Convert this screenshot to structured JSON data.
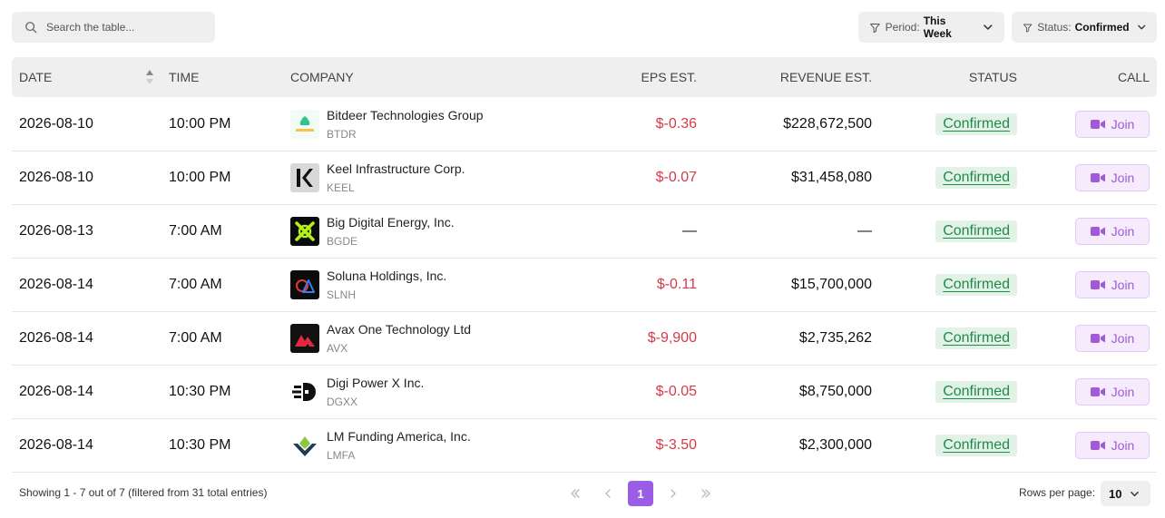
{
  "search": {
    "placeholder": "Search the table..."
  },
  "filters": {
    "period": {
      "label": "Period:",
      "value": "This Week"
    },
    "status": {
      "label": "Status:",
      "value": "Confirmed"
    }
  },
  "table": {
    "headers": {
      "date": "DATE",
      "time": "TIME",
      "company": "COMPANY",
      "eps": "EPS EST.",
      "revenue": "REVENUE EST.",
      "status": "STATUS",
      "call": "CALL"
    },
    "rows": [
      {
        "date": "2026-08-10",
        "time": "10:00 PM",
        "company": "Bitdeer Technologies Group",
        "ticker": "BTDR",
        "logo": "bitdeer-logo",
        "eps": "$-0.36",
        "revenue": "$228,672,500",
        "status": "Confirmed",
        "call": "Join"
      },
      {
        "date": "2026-08-10",
        "time": "10:00 PM",
        "company": "Keel Infrastructure Corp.",
        "ticker": "KEEL",
        "logo": "keel-logo",
        "eps": "$-0.07",
        "revenue": "$31,458,080",
        "status": "Confirmed",
        "call": "Join"
      },
      {
        "date": "2026-08-13",
        "time": "7:00 AM",
        "company": "Big Digital Energy, Inc.",
        "ticker": "BGDE",
        "logo": "bgde-logo",
        "eps": "—",
        "revenue": "—",
        "status": "Confirmed",
        "call": "Join"
      },
      {
        "date": "2026-08-14",
        "time": "7:00 AM",
        "company": "Soluna Holdings, Inc.",
        "ticker": "SLNH",
        "logo": "soluna-logo",
        "eps": "$-0.11",
        "revenue": "$15,700,000",
        "status": "Confirmed",
        "call": "Join"
      },
      {
        "date": "2026-08-14",
        "time": "7:00 AM",
        "company": "Avax One Technology Ltd",
        "ticker": "AVX",
        "logo": "avax-logo",
        "eps": "$-9,900",
        "revenue": "$2,735,262",
        "status": "Confirmed",
        "call": "Join"
      },
      {
        "date": "2026-08-14",
        "time": "10:30 PM",
        "company": "Digi Power X Inc.",
        "ticker": "DGXX",
        "logo": "digipower-logo",
        "eps": "$-0.05",
        "revenue": "$8,750,000",
        "status": "Confirmed",
        "call": "Join"
      },
      {
        "date": "2026-08-14",
        "time": "10:30 PM",
        "company": "LM Funding America, Inc.",
        "ticker": "LMFA",
        "logo": "lmfunding-logo",
        "eps": "$-3.50",
        "revenue": "$2,300,000",
        "status": "Confirmed",
        "call": "Join"
      }
    ]
  },
  "footer": {
    "showing": "Showing 1 - 7 out of 7 (filtered from 31 total entries)",
    "current_page": "1",
    "rows_per_page_label": "Rows per page:",
    "rows_per_page": "10"
  },
  "colors": {
    "negative": "#d63a4a",
    "confirmed_bg": "#e3f2e7",
    "confirmed_text": "#1f8a4c",
    "join_bg": "#f6ebfd",
    "join_text": "#a05ad8",
    "page_active": "#9b5de5"
  }
}
